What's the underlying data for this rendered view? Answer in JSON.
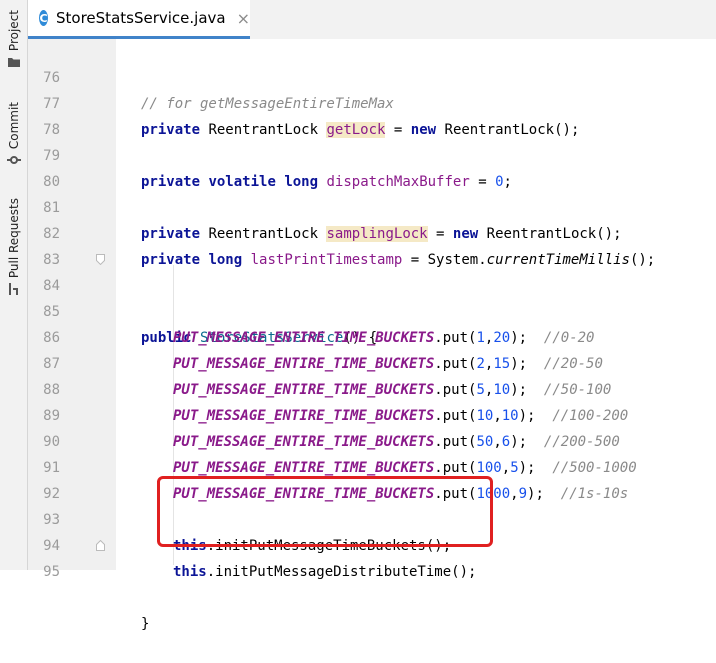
{
  "toolwindows": [
    {
      "label": "Project"
    },
    {
      "label": "Commit"
    },
    {
      "label": "Pull Requests"
    }
  ],
  "tab": {
    "icon_letter": "C",
    "filename": "StoreStatsService.java",
    "close": "×"
  },
  "lines": [
    {
      "num": "76"
    },
    {
      "num": "77"
    },
    {
      "num": "78"
    },
    {
      "num": "79"
    },
    {
      "num": "80"
    },
    {
      "num": "81"
    },
    {
      "num": "82"
    },
    {
      "num": "83"
    },
    {
      "num": "84"
    },
    {
      "num": "85"
    },
    {
      "num": "86"
    },
    {
      "num": "87"
    },
    {
      "num": "88"
    },
    {
      "num": "89"
    },
    {
      "num": "90"
    },
    {
      "num": "91"
    },
    {
      "num": "92"
    },
    {
      "num": "93"
    },
    {
      "num": "94"
    },
    {
      "num": "95"
    }
  ],
  "code": {
    "l76_comment": "// for getMessageEntireTimeMax",
    "kw_private": "private",
    "kw_new": "new",
    "kw_volatile": "volatile",
    "kw_long": "long",
    "kw_public": "public",
    "kw_this": "this",
    "reentrant": "ReentrantLock",
    "ctor_call": "ReentrantLock();",
    "f_getLock": "getLock",
    "f_dispatch": "dispatchMaxBuffer",
    "f_sampling": "samplingLock",
    "f_lastPrint": "lastPrintTimestamp",
    "eq": " = ",
    "zero": "0",
    "semi": ";",
    "system": "System.",
    "currentTime": "currentTimeMillis",
    "call_end": "();",
    "ctor_name": "StoreStatsService",
    "ctor_open": "() {",
    "const_name": "PUT_MESSAGE_ENTIRE_TIME_BUCKETS",
    "put": ".put(",
    "comma": ",",
    "close_paren": ");",
    "buckets": [
      {
        "a": "1",
        "b": "20",
        "pad": "  ",
        "comment": "//0-20"
      },
      {
        "a": "2",
        "b": "15",
        "pad": "  ",
        "comment": "//20-50"
      },
      {
        "a": "5",
        "b": "10",
        "pad": "  ",
        "comment": "//50-100"
      },
      {
        "a": "10",
        "b": "10",
        "pad": "  ",
        "comment": "//100-200"
      },
      {
        "a": "50",
        "b": "6",
        "pad": "  ",
        "comment": "//200-500"
      },
      {
        "a": "100",
        "b": "5",
        "pad": "  ",
        "comment": "//500-1000"
      },
      {
        "a": "1000",
        "b": "9",
        "pad": "  ",
        "comment": "//1s-10s"
      }
    ],
    "dot_init1": ".initPutMessageTimeBuckets();",
    "dot_init2": ".initPutMessageDistributeTime();",
    "closing_brace": "}"
  },
  "colors": {
    "keyword": "#0b1496",
    "field": "#8a1a8a",
    "number": "#1750eb",
    "comment": "#8a8a8a",
    "highlight_box": "#e02020",
    "tab_underline": "#4083c9"
  }
}
